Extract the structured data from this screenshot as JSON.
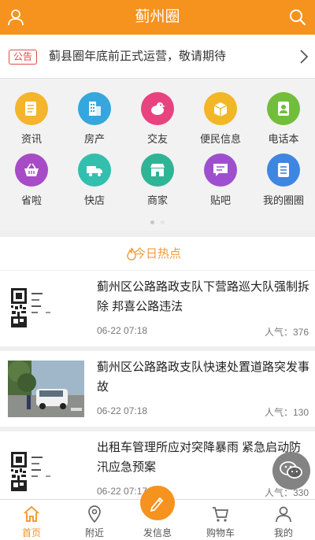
{
  "header": {
    "title": "蓟州圈"
  },
  "notice": {
    "badge": "公告",
    "text": "蓟县圈年底前正式运营，敬请期待"
  },
  "grid": [
    {
      "label": "资讯",
      "icon": "news-icon",
      "color": "#f4b52b"
    },
    {
      "label": "房产",
      "icon": "building-icon",
      "color": "#35a7dd"
    },
    {
      "label": "交友",
      "icon": "bird-icon",
      "color": "#e8437f"
    },
    {
      "label": "便民信息",
      "icon": "box-icon",
      "color": "#f3b627"
    },
    {
      "label": "电话本",
      "icon": "phonebook-icon",
      "color": "#72be3c"
    },
    {
      "label": "省啦",
      "icon": "basket-icon",
      "color": "#a74bc6"
    },
    {
      "label": "快店",
      "icon": "truck-icon",
      "color": "#33bfae"
    },
    {
      "label": "商家",
      "icon": "shop-icon",
      "color": "#2fb495"
    },
    {
      "label": "贴吧",
      "icon": "chat-icon",
      "color": "#9e4fd0"
    },
    {
      "label": "我的圈圈",
      "icon": "list-icon",
      "color": "#3e86e0"
    }
  ],
  "hot": {
    "title": "今日热点"
  },
  "news": [
    {
      "title": "蓟州区公路路政支队下营路巡大队强制拆除 邦喜公路违法",
      "date": "06-22 07:18",
      "popularity": "人气：376",
      "thumb": "qr-thumbnail"
    },
    {
      "title": "蓟州区公路路政支队快速处置道路突发事故",
      "date": "06-22 07:18",
      "popularity": "人气：130",
      "thumb": "road-accident-photo"
    },
    {
      "title": "出租车管理所应对突降暴雨 紧急启动防汛应急预案",
      "date": "06-22 07:17",
      "popularity": "人气：330",
      "thumb": "qr-thumbnail"
    }
  ],
  "tabs": [
    {
      "label": "首页",
      "icon": "home-icon"
    },
    {
      "label": "附近",
      "icon": "location-icon"
    },
    {
      "label": "发信息",
      "icon": "pen-icon"
    },
    {
      "label": "购物车",
      "icon": "cart-icon"
    },
    {
      "label": "我的",
      "icon": "person-icon"
    }
  ],
  "colors": {
    "brand": "#f6921e",
    "notice": "#e24a4a"
  }
}
